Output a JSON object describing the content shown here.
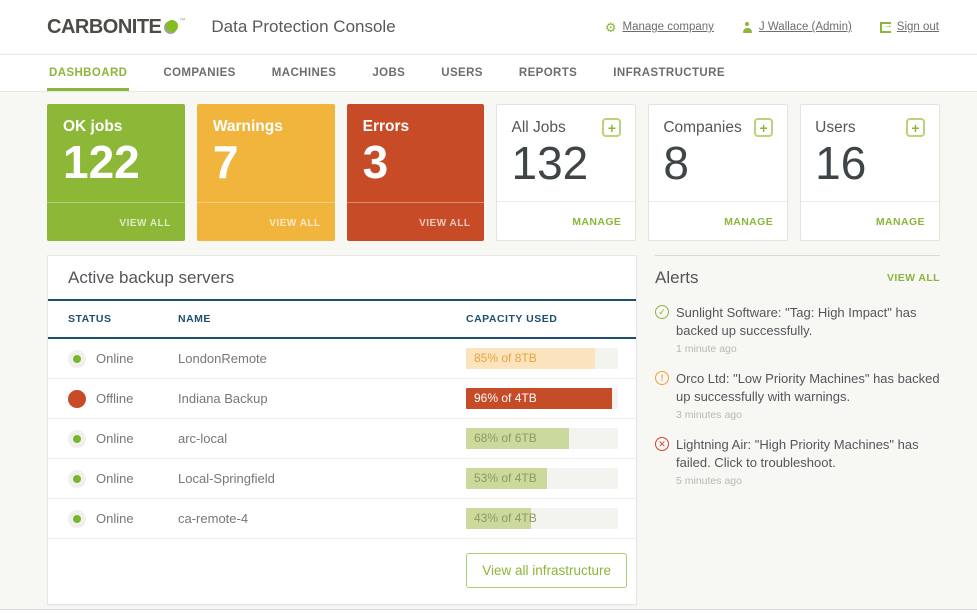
{
  "header": {
    "logo": "CARBONITE",
    "logo_tm": "™",
    "app_title": "Data Protection Console",
    "links": {
      "manage_company": "Manage company",
      "user": "J Wallace (Admin)",
      "sign_out": "Sign out"
    }
  },
  "nav": {
    "tabs": [
      {
        "label": "DASHBOARD",
        "active": true
      },
      {
        "label": "COMPANIES",
        "active": false
      },
      {
        "label": "MACHINES",
        "active": false
      },
      {
        "label": "JOBS",
        "active": false
      },
      {
        "label": "USERS",
        "active": false
      },
      {
        "label": "REPORTS",
        "active": false
      },
      {
        "label": "INFRASTRUCTURE",
        "active": false
      }
    ]
  },
  "metric_cards": [
    {
      "title": "OK jobs",
      "value": "122",
      "link": "VIEW ALL",
      "color": "#8cb737"
    },
    {
      "title": "Warnings",
      "value": "7",
      "link": "VIEW ALL",
      "color": "#f1b53d"
    },
    {
      "title": "Errors",
      "value": "3",
      "link": "VIEW ALL",
      "color": "#c74b27"
    }
  ],
  "summary_cards": [
    {
      "title": "All Jobs",
      "value": "132",
      "link": "MANAGE",
      "action_icon": "plus-icon"
    },
    {
      "title": "Companies",
      "value": "8",
      "link": "MANAGE",
      "action_icon": "plus-icon"
    },
    {
      "title": "Users",
      "value": "16",
      "link": "MANAGE",
      "action_icon": "plus-icon"
    }
  ],
  "servers": {
    "title": "Active backup servers",
    "columns": {
      "status": "STATUS",
      "name": "NAME",
      "capacity": "CAPACITY USED"
    },
    "rows": [
      {
        "status": "Online",
        "name": "LondonRemote",
        "capacity": "85% of 8TB",
        "percent": 85,
        "level": "warning"
      },
      {
        "status": "Offline",
        "name": "Indiana Backup",
        "capacity": "96% of 4TB",
        "percent": 96,
        "level": "critical"
      },
      {
        "status": "Online",
        "name": "arc-local",
        "capacity": "68% of 6TB",
        "percent": 68,
        "level": "ok"
      },
      {
        "status": "Online",
        "name": "Local-Springfield",
        "capacity": "53% of 4TB",
        "percent": 53,
        "level": "ok"
      },
      {
        "status": "Online",
        "name": "ca-remote-4",
        "capacity": "43% of 4TB",
        "percent": 43,
        "level": "ok"
      }
    ],
    "footer_button": "View all infrastructure"
  },
  "alerts": {
    "title": "Alerts",
    "view_all": "VIEW ALL",
    "items": [
      {
        "type": "success",
        "glyph": "✓",
        "text": "Sunlight Software: \"Tag: High Impact\" has backed up successfully.",
        "time": "1 minute ago"
      },
      {
        "type": "warning",
        "glyph": "!",
        "text": "Orco Ltd: \"Low Priority Machines\" has backed up successfully with warnings.",
        "time": "3 minutes ago"
      },
      {
        "type": "error",
        "glyph": "✕",
        "text": "Lightning Air: \"High Priority Machines\" has failed. Click to troubleshoot.",
        "time": "5 minutes ago"
      }
    ]
  },
  "colors": {
    "brand_green": "#8bb63b",
    "ok_green": "#8cb737",
    "warning_yellow": "#f1b53d",
    "error_red": "#c74b27",
    "table_navy": "#1d4f6e",
    "page_bg": "#f7f7f4"
  }
}
